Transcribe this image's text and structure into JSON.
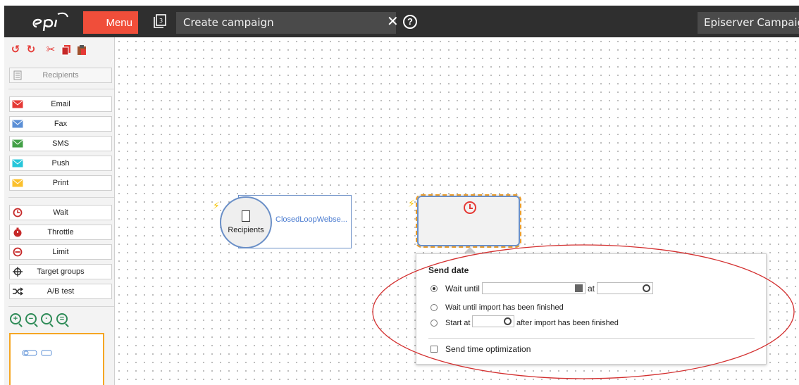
{
  "header": {
    "menu_label": "Menu",
    "campaign_title": "Create campaign",
    "app_name": "Episerver Campaign",
    "counter_value": "3"
  },
  "sidebar": {
    "toolbar_icons": [
      "undo-icon",
      "redo-icon",
      "cut-icon",
      "copy-icon",
      "paste-icon"
    ],
    "recipients_label": "Recipients",
    "channel_items": [
      {
        "label": "Email",
        "color": "#e53935"
      },
      {
        "label": "Fax",
        "color": "#5b8fd6"
      },
      {
        "label": "SMS",
        "color": "#43a047"
      },
      {
        "label": "Push",
        "color": "#26c6da"
      },
      {
        "label": "Print",
        "color": "#fbc02d"
      }
    ],
    "logic_items": [
      {
        "label": "Wait",
        "icon": "clock-icon"
      },
      {
        "label": "Throttle",
        "icon": "stopwatch-icon"
      },
      {
        "label": "Limit",
        "icon": "limit-icon"
      },
      {
        "label": "Target groups",
        "icon": "crosshair-icon"
      },
      {
        "label": "A/B test",
        "icon": "shuffle-icon"
      }
    ],
    "zoom_icons": [
      "zoom-in-icon",
      "zoom-out-icon",
      "zoom-reset-icon",
      "zoom-fit-icon"
    ]
  },
  "canvas": {
    "recipients_node_label": "Recipients",
    "recipients_node_name": "ClosedLoopWebse..."
  },
  "popup": {
    "heading": "Send date",
    "option_wait_until": "Wait until",
    "at_label": "at",
    "option_wait_import": "Wait until import has been finished",
    "option_start_at": "Start at",
    "after_import_label": "after import has been finished",
    "send_time_optimization": "Send time optimization",
    "selected_option": "Wait until"
  },
  "colors": {
    "accent_red": "#f04e3a",
    "header_bg": "#2f2f2f",
    "node_border": "#6a8fc7",
    "selection_orange": "#e89b2a",
    "annotation_red": "#d32f2f"
  }
}
